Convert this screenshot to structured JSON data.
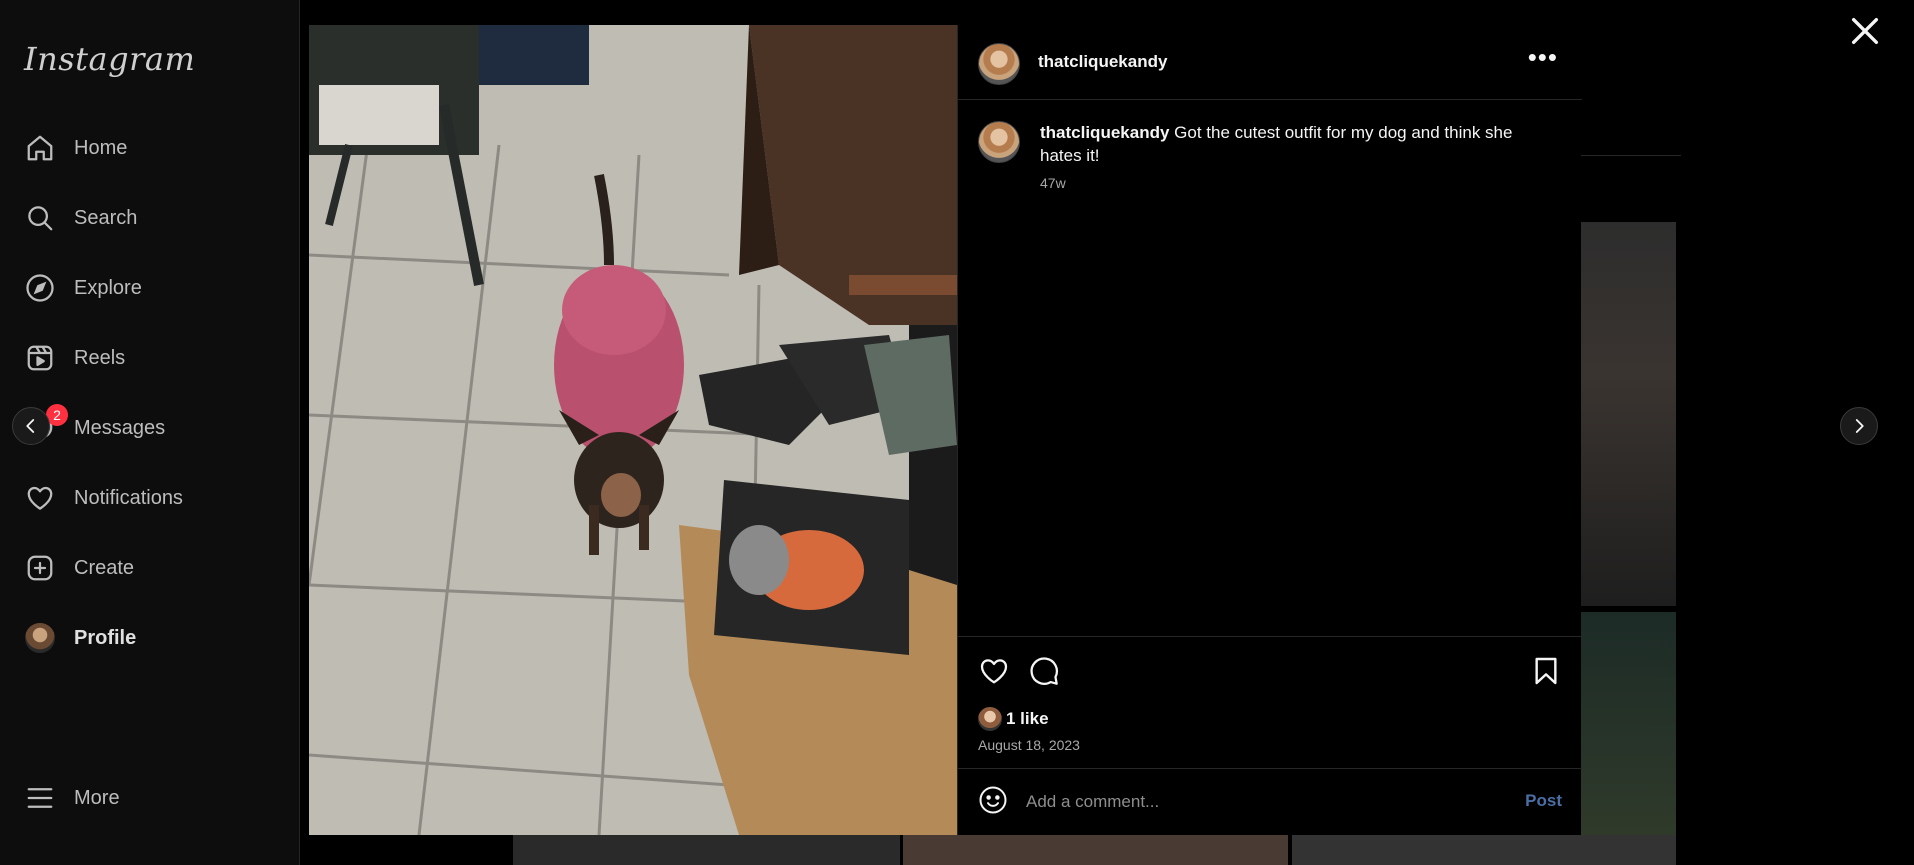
{
  "app": {
    "logo": "Instagram"
  },
  "sidebar": {
    "items": [
      {
        "label": "Home",
        "icon": "home-icon"
      },
      {
        "label": "Search",
        "icon": "search-icon"
      },
      {
        "label": "Explore",
        "icon": "compass-icon"
      },
      {
        "label": "Reels",
        "icon": "reels-icon"
      },
      {
        "label": "Messages",
        "icon": "messenger-icon",
        "badge": "2"
      },
      {
        "label": "Notifications",
        "icon": "heart-icon"
      },
      {
        "label": "Create",
        "icon": "plus-square-icon"
      },
      {
        "label": "Profile",
        "icon": "avatar"
      },
      {
        "label": "More",
        "icon": "menu-icon"
      }
    ]
  },
  "post": {
    "username": "thatcliquekandy",
    "caption_text": "Got the cutest outfit for my dog and think she hates it!",
    "time_ago": "47w",
    "likes": "1 like",
    "date": "August 18, 2023",
    "comment_placeholder": "Add a comment...",
    "post_label": "Post"
  },
  "colors": {
    "accent": "#0095f6",
    "post_button_inactive": "#4a6fa5",
    "badge": "#ff3040",
    "background": "#000000"
  }
}
